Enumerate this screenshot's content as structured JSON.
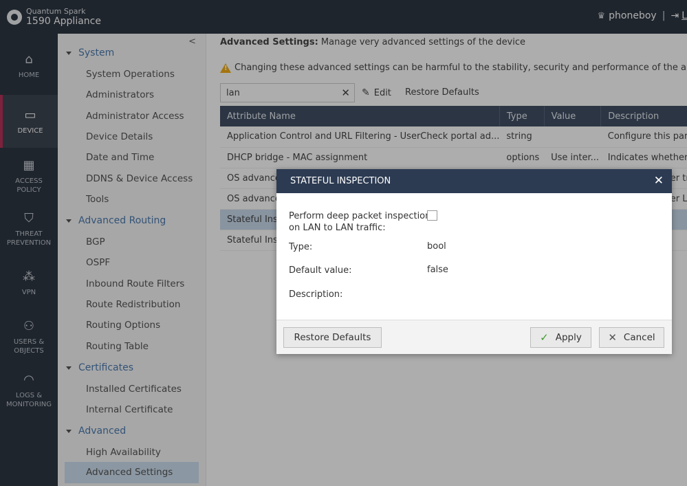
{
  "header": {
    "brand_line1": "Quantum Spark",
    "brand_line2": "1590 Appliance",
    "username": "phoneboy",
    "separator": "|",
    "logout_label": "L"
  },
  "leftnav": [
    {
      "label": "HOME",
      "icon": "home-icon"
    },
    {
      "label": "DEVICE",
      "icon": "device-icon",
      "active": true
    },
    {
      "label": "ACCESS POLICY",
      "icon": "access-policy-icon"
    },
    {
      "label": "THREAT PREVENTION",
      "icon": "shield-icon"
    },
    {
      "label": "VPN",
      "icon": "vpn-icon"
    },
    {
      "label": "USERS & OBJECTS",
      "icon": "users-icon"
    },
    {
      "label": "LOGS & MONITORING",
      "icon": "gauge-icon"
    }
  ],
  "tree": {
    "sections": [
      {
        "label": "System",
        "items": [
          "System Operations",
          "Administrators",
          "Administrator Access",
          "Device Details",
          "Date and Time",
          "DDNS & Device Access",
          "Tools"
        ]
      },
      {
        "label": "Advanced Routing",
        "items": [
          "BGP",
          "OSPF",
          "Inbound Route Filters",
          "Route Redistribution",
          "Routing Options",
          "Routing Table"
        ]
      },
      {
        "label": "Certificates",
        "items": [
          "Installed Certificates",
          "Internal Certificate"
        ]
      },
      {
        "label": "Advanced",
        "items": [
          "High Availability",
          "Advanced Settings"
        ]
      }
    ],
    "selected": "Advanced Settings"
  },
  "main": {
    "title_bold": "Advanced Settings:",
    "title_rest": " Manage very advanced settings of the device",
    "warning": "Changing these advanced settings can be harmful to the stability, security and performance of the appliance",
    "search_value": "lan",
    "edit_label": "Edit",
    "restore_label": "Restore Defaults",
    "columns": [
      "Attribute Name",
      "Type",
      "Value",
      "Description"
    ],
    "rows": [
      {
        "name": "Application Control and URL Filtering - UserCheck portal ad...",
        "type": "string",
        "value": "",
        "desc": "Configure this para"
      },
      {
        "name": "DHCP bridge - MAC assignment",
        "type": "options",
        "value": "Use inter...",
        "desc": "Indicates whether th"
      },
      {
        "name": "OS advanced",
        "type": "",
        "value": "",
        "desc": "er tr"
      },
      {
        "name": "OS advanced",
        "type": "",
        "value": "",
        "desc": "er L"
      },
      {
        "name": "Stateful Insp",
        "type": "",
        "value": "",
        "desc": ""
      },
      {
        "name": "Stateful Insp",
        "type": "",
        "value": "",
        "desc": ""
      }
    ]
  },
  "dialog": {
    "title": "STATEFUL INSPECTION",
    "field_label_1": "Perform deep packet inspection",
    "field_label_2": "on LAN to LAN traffic:",
    "type_label": "Type:",
    "type_value": "bool",
    "default_label": "Default value:",
    "default_value": "false",
    "description_label": "Description:",
    "restore_button": "Restore Defaults",
    "apply_button": "Apply",
    "cancel_button": "Cancel"
  }
}
